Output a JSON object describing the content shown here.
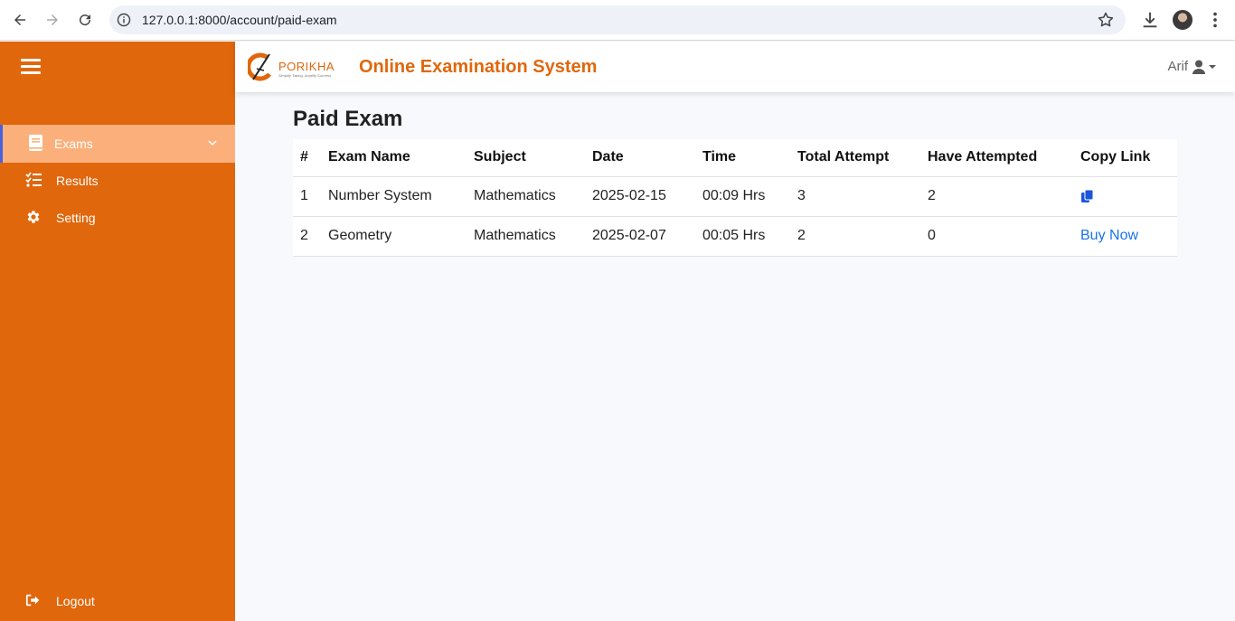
{
  "browser": {
    "url": "127.0.0.1:8000/account/paid-exam"
  },
  "sidebar": {
    "items": [
      {
        "label": "Exams",
        "icon": "book-icon",
        "active": true
      },
      {
        "label": "Results",
        "icon": "list-check-icon",
        "active": false
      },
      {
        "label": "Setting",
        "icon": "gear-icon",
        "active": false
      }
    ],
    "logout_label": "Logout"
  },
  "header": {
    "logo_text": "PORIKHA",
    "logo_tagline": "Simplify Taking, Amplify Success",
    "title": "Online Examination System",
    "user_name": "Arif"
  },
  "main": {
    "page_title": "Paid Exam",
    "table": {
      "headers": [
        "#",
        "Exam Name",
        "Subject",
        "Date",
        "Time",
        "Total Attempt",
        "Have Attempted",
        "Copy Link"
      ],
      "rows": [
        {
          "num": "1",
          "name": "Number System",
          "subject": "Mathematics",
          "date": "2025-02-15",
          "time": "00:09 Hrs",
          "total": "3",
          "attempted": "2",
          "action": "copy"
        },
        {
          "num": "2",
          "name": "Geometry",
          "subject": "Mathematics",
          "date": "2025-02-07",
          "time": "00:05 Hrs",
          "total": "2",
          "attempted": "0",
          "action": "Buy Now"
        }
      ]
    }
  },
  "colors": {
    "brand": "#e0670c",
    "active_item": "#fbb07b",
    "link": "#1a73e8"
  }
}
